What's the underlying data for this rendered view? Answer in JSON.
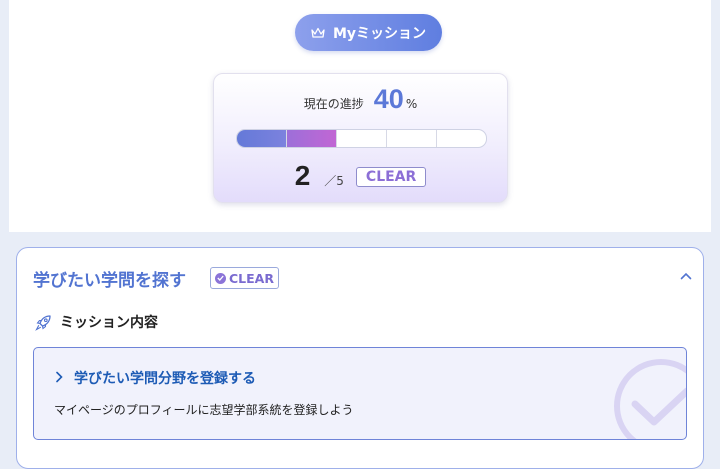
{
  "header": {
    "mission_button_label": "Myミッション"
  },
  "progress": {
    "rate_label": "現在の進捗",
    "rate_value": "40",
    "rate_unit": "%",
    "completed": "2",
    "total": "／5",
    "segments_total": 5,
    "segments_filled": 2,
    "clear_label": "CLEAR"
  },
  "mission": {
    "title": "学びたい学問を探す",
    "badge_label": "CLEAR",
    "content_heading": "ミッション内容",
    "task": {
      "title": "学びたい学問分野を登録する",
      "description": "マイページのプロフィールに志望学部系統を登録しよう"
    }
  },
  "colors": {
    "accent": "#5b78d8",
    "progress_fill_1": "#6479d8",
    "progress_fill_2": "#c166d4",
    "task_title": "#1d5bb5"
  },
  "icons": [
    "crown-icon",
    "check-circle-icon",
    "chevron-up-icon",
    "rocket-icon",
    "chevron-right-icon",
    "check-watermark-icon"
  ]
}
